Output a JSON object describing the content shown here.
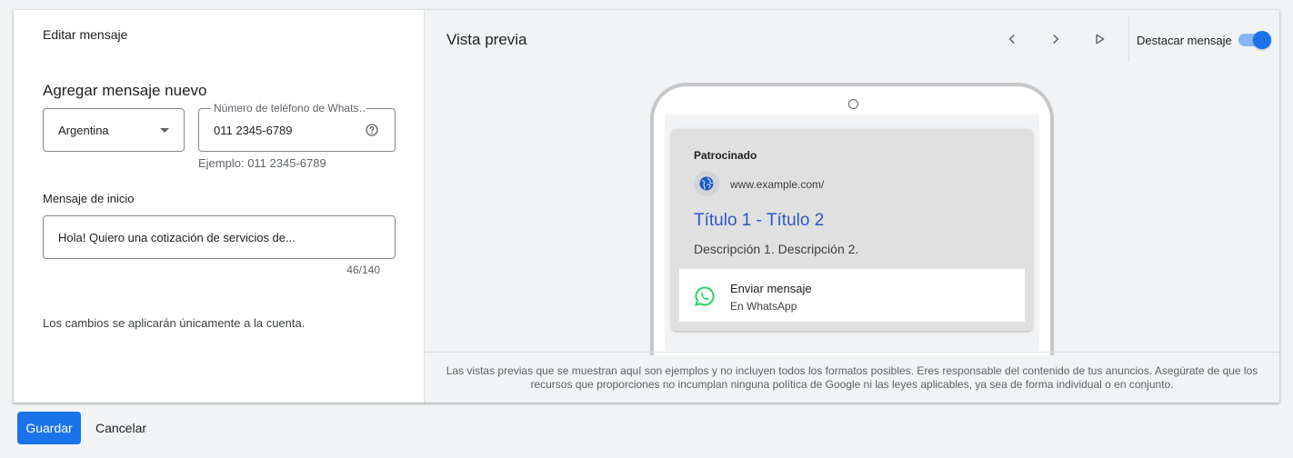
{
  "editor": {
    "title": "Editar mensaje",
    "section_title": "Agregar mensaje nuevo",
    "country": {
      "selected": "Argentina"
    },
    "phone": {
      "label": "Número de teléfono de Whats",
      "value": "011 2345-6789",
      "hint": "Ejemplo: 011 2345-6789",
      "help_icon": "help-circle-icon"
    },
    "message": {
      "label": "Mensaje de inicio",
      "value": "Hola! Quiero una cotización de servicios de...",
      "counter": "46/140"
    },
    "footer_note": "Los cambios se aplicarán únicamente a la cuenta."
  },
  "preview": {
    "title": "Vista previa",
    "controls": {
      "prev_icon": "chevron-left-icon",
      "next_icon": "chevron-right-icon",
      "play_icon": "play-icon"
    },
    "highlight_label": "Destacar mensaje",
    "highlight_on": true,
    "ad": {
      "sponsored": "Patrocinado",
      "url": "www.example.com/",
      "headline": "Título 1 - Título 2",
      "description": "Descripción 1. Descripción 2.",
      "cta_title": "Enviar mensaje",
      "cta_subtitle": "En WhatsApp"
    },
    "disclaimer": "Las vistas previas que se muestran aquí son ejemplos y no incluyen todos los formatos posibles. Eres responsable del contenido de tus anuncios. Asegúrate de que los recursos que proporciones no incumplan ninguna política de Google ni las leyes aplicables, ya sea de forma individual o en conjunto."
  },
  "actions": {
    "save": "Guardar",
    "cancel": "Cancelar"
  },
  "colors": {
    "primary": "#1a73e8",
    "headline": "#2b57c9",
    "whatsapp": "#25d366"
  }
}
